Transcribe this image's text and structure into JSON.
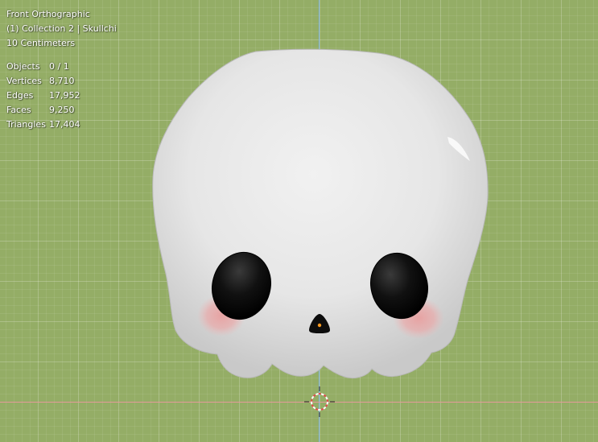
{
  "viewport": {
    "view_name": "Front Orthographic",
    "collection_info": "(1) Collection 2 | Skullchi",
    "grid_scale": "10 Centimeters",
    "background_color": "#94ad66",
    "stats": [
      {
        "label": "Objects",
        "value": "0 / 1"
      },
      {
        "label": "Vertices",
        "value": "8,710"
      },
      {
        "label": "Edges",
        "value": "17,952"
      },
      {
        "label": "Faces",
        "value": "9,250"
      },
      {
        "label": "Triangles",
        "value": "17,404"
      }
    ]
  },
  "scene": {
    "model_name": "skull-model",
    "model_color": "#e8e8e8",
    "eye_color": "#0d0d0d",
    "blush_color": "#e8a4a4",
    "cursor_icon": "3d-cursor-icon"
  }
}
